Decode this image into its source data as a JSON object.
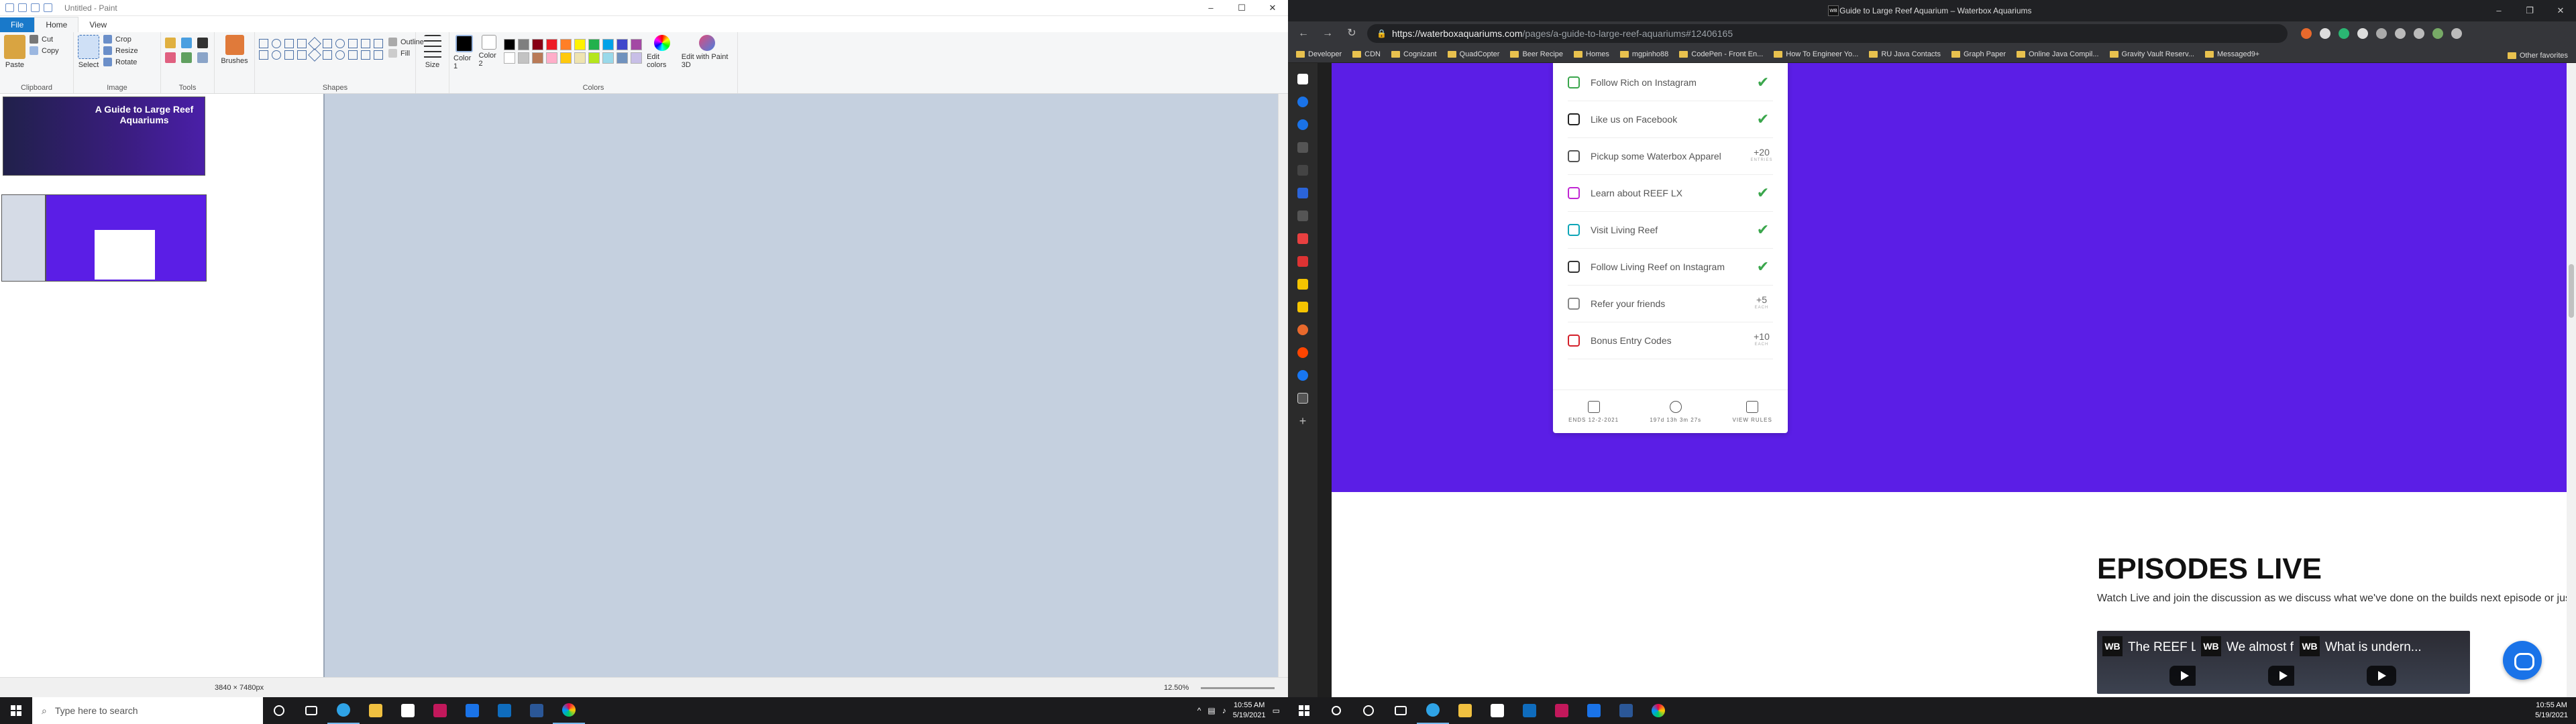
{
  "paint": {
    "title": "Untitled - Paint",
    "window_controls": [
      "–",
      "☐",
      "✕"
    ],
    "tabs": [
      {
        "label": "File"
      },
      {
        "label": "Home"
      },
      {
        "label": "View"
      }
    ],
    "clipboard": {
      "paste": "Paste",
      "cut": "Cut",
      "copy": "Copy",
      "group": "Clipboard"
    },
    "image": {
      "select": "Select",
      "crop": "Crop",
      "resize": "Resize",
      "rotate": "Rotate",
      "group": "Image"
    },
    "tools_group": "Tools",
    "brushes": "Brushes",
    "shapes": {
      "outline": "Outline",
      "fill": "Fill",
      "group": "Shapes"
    },
    "size": "Size",
    "color1": "Color 1",
    "color2": "Color 2",
    "colors_group": "Colors",
    "edit_colors": "Edit colors",
    "edit_3d": "Edit with Paint 3D",
    "palette": [
      "#000000",
      "#7f7f7f",
      "#880015",
      "#ed1c24",
      "#ff7f27",
      "#fff200",
      "#22b14c",
      "#00a2e8",
      "#3f48cc",
      "#a349a4",
      "#ffffff",
      "#c3c3c3",
      "#b97a57",
      "#ffaec9",
      "#ffc90e",
      "#efe4b0",
      "#b5e61d",
      "#99d9ea",
      "#7092be",
      "#c8bfe7"
    ],
    "thumb_title": "A Guide to Large Reef Aquariums",
    "status_dims": "3840 × 7480px",
    "zoom": "12.50%"
  },
  "browser": {
    "title": "A Guide to Large Reef Aquarium – Waterbox Aquariums",
    "favicon_text": "WB",
    "window_controls": [
      "–",
      "❐",
      "✕"
    ],
    "url_host": "https://waterboxaquariums.com",
    "url_path": "/pages/a-guide-to-large-reef-aquariums#12406165",
    "bookmarks": [
      "Developer",
      "CDN",
      "Cognizant",
      "QuadCopter",
      "Beer Recipe",
      "Homes",
      "mgpinho88",
      "CodePen - Front En...",
      "How To Engineer Yo...",
      "RU Java Contacts",
      "Graph Paper",
      "Online Java Compil...",
      "Gravity Vault Reserv...",
      "Messaged9+"
    ],
    "other_favorites": "Other favorites"
  },
  "entries": [
    {
      "label": "Follow Rich on Instagram",
      "status": "✔",
      "icon": "instagram-icon",
      "color": "#3aa64c"
    },
    {
      "label": "Like us on Facebook",
      "status": "✔",
      "icon": "facebook-icon",
      "color": "#222222"
    },
    {
      "label": "Pickup some Waterbox Apparel",
      "status": "+20",
      "sub": "ENTRIES",
      "icon": "shirt-icon",
      "color": "#555555"
    },
    {
      "label": "Learn about REEF LX",
      "status": "✔",
      "icon": "monitor-icon",
      "color": "#c026d3"
    },
    {
      "label": "Visit Living Reef",
      "status": "✔",
      "icon": "monitor-icon",
      "color": "#0ea5b7"
    },
    {
      "label": "Follow Living Reef on Instagram",
      "status": "✔",
      "icon": "instagram-icon",
      "color": "#333333"
    },
    {
      "label": "Refer your friends",
      "status": "+5",
      "sub": "EACH",
      "icon": "megaphone-icon",
      "color": "#888888"
    },
    {
      "label": "Bonus Entry Codes",
      "status": "+10",
      "sub": "EACH",
      "icon": "key-icon",
      "color": "#d4202a"
    }
  ],
  "card_footer": {
    "ends": "ENDS 12-2-2021",
    "countdown": "197d 13h 3m 27s",
    "rules": "VIEW RULES"
  },
  "episodes": {
    "title": "EPISODES LIVE",
    "desc": "Watch Live and join the discussion as we discuss what we've done on the builds next episode or just \"Watch Video\" to view the episodes content at your own pace.",
    "videos": [
      {
        "badge": "WB",
        "title": "The REEF LX is ..."
      },
      {
        "badge": "WB",
        "title": "We almost floo..."
      },
      {
        "badge": "WB",
        "title": "What is undern..."
      }
    ]
  },
  "taskbar": {
    "search_placeholder": "Type here to search",
    "time": "10:55 AM",
    "date": "5/19/2021"
  }
}
